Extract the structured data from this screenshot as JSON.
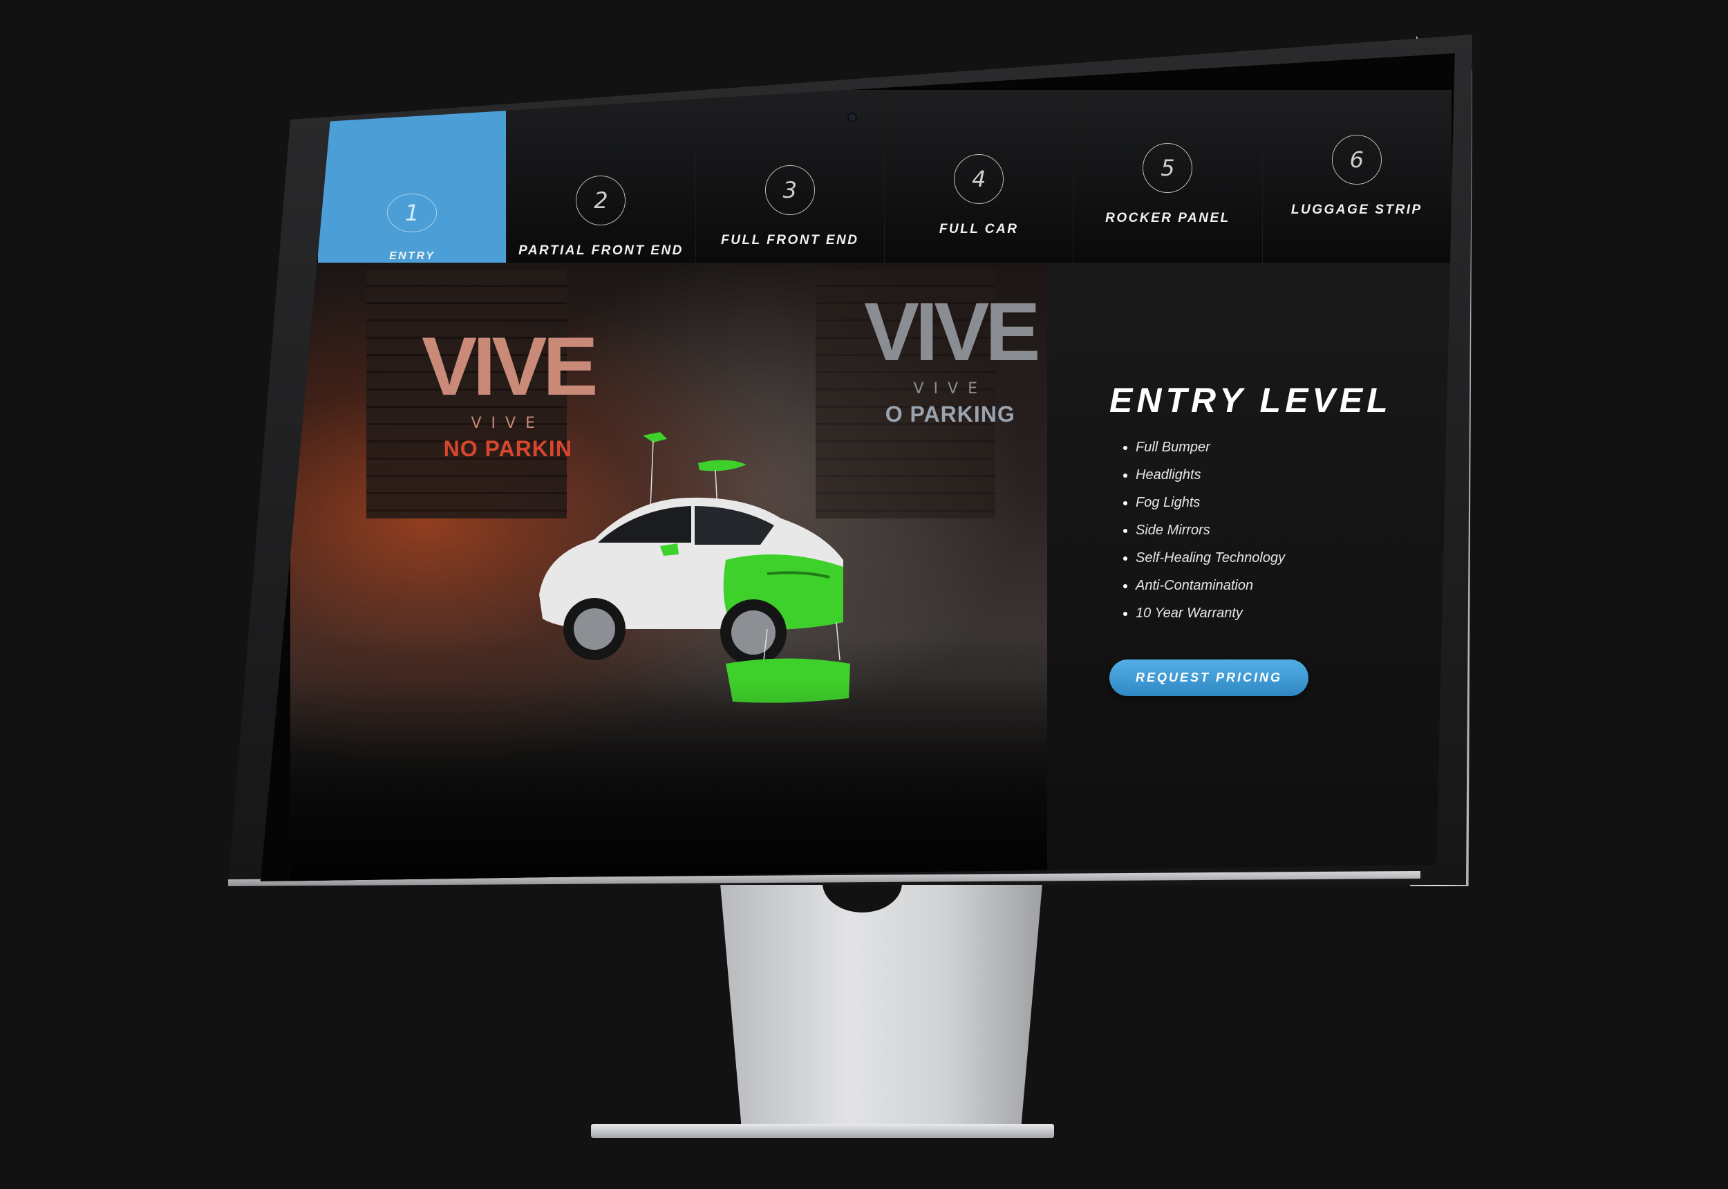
{
  "tabs": [
    {
      "number": "1",
      "label": "Entry",
      "active": true
    },
    {
      "number": "2",
      "label": "Partial Front End",
      "active": false
    },
    {
      "number": "3",
      "label": "Full Front End",
      "active": false
    },
    {
      "number": "4",
      "label": "Full Car",
      "active": false
    },
    {
      "number": "5",
      "label": "Rocker Panel",
      "active": false
    },
    {
      "number": "6",
      "label": "Luggage Strip",
      "active": false
    }
  ],
  "hero": {
    "logo_left": {
      "glyph": "VIVE",
      "word": "VIVE",
      "sign": "NO PARKIN"
    },
    "logo_right": {
      "glyph": "VIVE",
      "word": "VIVE",
      "sign": "O PARKING"
    }
  },
  "panel": {
    "title": "ENTRY LEVEL",
    "features": [
      "Full Bumper",
      "Headlights",
      "Fog Lights",
      "Side Mirrors",
      "Self-Healing Technology",
      "Anti-Contamination",
      "10 Year Warranty"
    ],
    "cta_label": "Request Pricing"
  },
  "colors": {
    "accent_blue": "#4b9fd6",
    "highlight_green": "#3fd12b",
    "background": "#121212"
  }
}
